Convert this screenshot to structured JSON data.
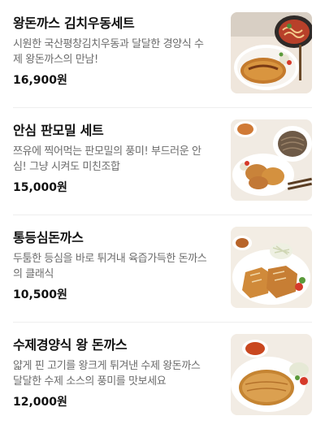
{
  "menu": {
    "items": [
      {
        "name": "왕돈까스 김치우동세트",
        "description_lines": [
          "시원한 국산평창김치우동과 달달한 경양식 수",
          "제 왕돈까스의 만남!"
        ],
        "price": "16,900원",
        "image_icon": "pork-cutlet-kimchi-udon-photo"
      },
      {
        "name": "안심 판모밀 세트",
        "description_lines": [
          "쯔유에 찍어먹는 판모밀의 풍미! 부드러운 안",
          "심! 그냥 시켜도 미친조합"
        ],
        "price": "15,000원",
        "image_icon": "tenderloin-cutlet-soba-photo"
      },
      {
        "name": "통등심돈까스",
        "description_lines": [
          "두툼한 등심을 바로 튀겨내 육즙가득한 돈까스",
          "의 클래식"
        ],
        "price": "10,500원",
        "image_icon": "thick-loin-cutlet-photo"
      },
      {
        "name": "수제경양식 왕 돈까스",
        "description_lines": [
          "얇게 핀 고기를 왕크게 튀겨낸 수제 왕돈까스",
          "달달한 수제 소스의 풍미를 맛보세요"
        ],
        "price": "12,000원",
        "image_icon": "handmade-western-cutlet-photo"
      }
    ]
  }
}
